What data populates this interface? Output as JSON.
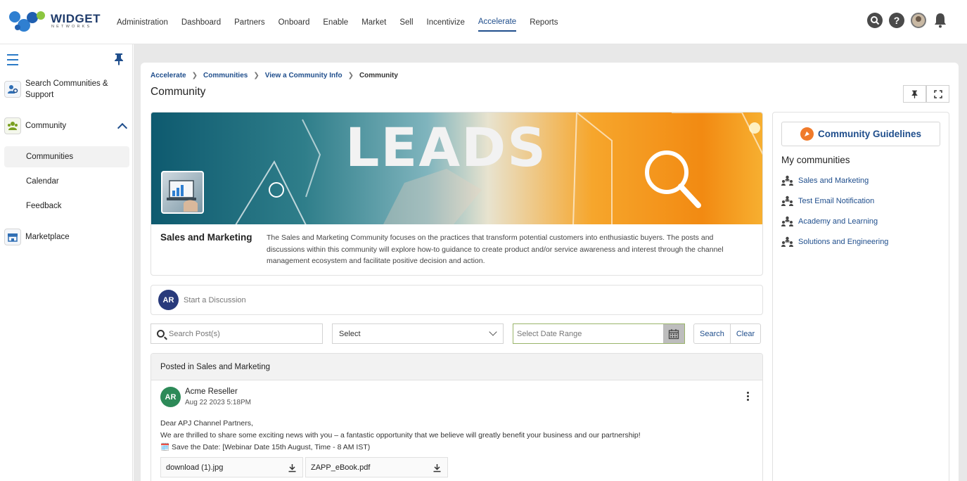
{
  "brand": {
    "name": "WIDGET",
    "tagline": "NETWORKS"
  },
  "nav": {
    "items": [
      {
        "label": "Administration"
      },
      {
        "label": "Dashboard"
      },
      {
        "label": "Partners"
      },
      {
        "label": "Onboard"
      },
      {
        "label": "Enable"
      },
      {
        "label": "Market"
      },
      {
        "label": "Sell"
      },
      {
        "label": "Incentivize"
      },
      {
        "label": "Accelerate",
        "active": true
      },
      {
        "label": "Reports"
      }
    ],
    "icons": [
      "search-icon",
      "help-icon",
      "user-avatar",
      "bell-icon"
    ]
  },
  "sidebar": {
    "search_label": "Search Communities & Support",
    "community_label": "Community",
    "sub_items": [
      {
        "label": "Communities",
        "active": true
      },
      {
        "label": "Calendar"
      },
      {
        "label": "Feedback"
      }
    ],
    "marketplace_label": "Marketplace"
  },
  "breadcrumb": {
    "items": [
      "Accelerate",
      "Communities",
      "View a Community Info"
    ],
    "current": "Community"
  },
  "page_title": "Community",
  "banner": {
    "word": "LEADS",
    "community_name": "Sales and Marketing",
    "description": "The Sales and Marketing Community focuses on the practices that transform potential customers into enthusiastic buyers. The posts and discussions within this community will explore how-to guidance to create product and/or service awareness and interest through the channel management ecosystem and facilitate positive decision and action."
  },
  "discussion": {
    "avatar_initials": "AR",
    "placeholder": "Start a Discussion"
  },
  "filters": {
    "search_placeholder": "Search Post(s)",
    "select_value": "Select",
    "date_placeholder": "Select Date Range",
    "search_button": "Search",
    "clear_button": "Clear"
  },
  "posts": {
    "header": "Posted in Sales and Marketing",
    "items": [
      {
        "avatar_initials": "AR",
        "author": "Acme Reseller",
        "date": "Aug 22 2023 5:18PM",
        "lines": [
          "Dear APJ Channel Partners,",
          "We are thrilled to share some exciting news with you – a fantastic opportunity that we believe will greatly benefit your business and our partnership!",
          "🗓️ Save the Date: [Webinar Date 15th August, Time - 8 AM IST)"
        ],
        "attachments": [
          {
            "name": "download (1).jpg"
          },
          {
            "name": "ZAPP_eBook.pdf"
          }
        ]
      }
    ]
  },
  "right_panel": {
    "guidelines_label": "Community Guidelines",
    "my_communities_title": "My communities",
    "communities": [
      {
        "label": "Sales and Marketing"
      },
      {
        "label": "Test Email Notification"
      },
      {
        "label": "Academy and Learning"
      },
      {
        "label": "Solutions and Engineering"
      }
    ]
  },
  "colors": {
    "accent": "#1f4e8c",
    "avatar_blue": "#283a7b",
    "avatar_green": "#2d8a58",
    "guidelines_orange": "#f07a2a"
  }
}
